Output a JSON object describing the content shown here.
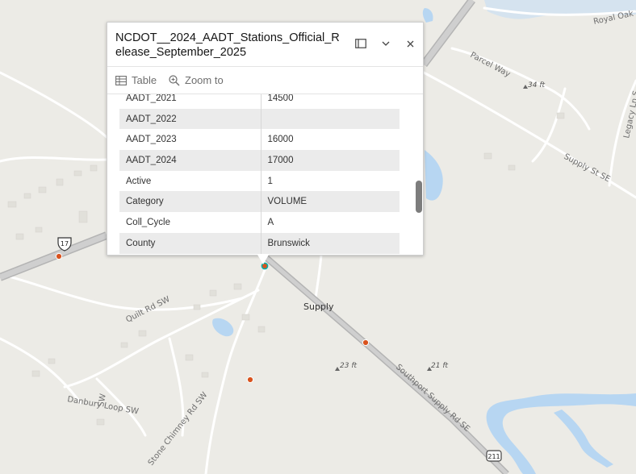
{
  "map": {
    "town_label": "Supply",
    "road_labels": {
      "southport_supply": "Southport Supply Rd SE",
      "quilt": "Quilt Rd SW",
      "danbury": "Danbury Loop SW",
      "stone_chimney": "Stone Chimney Rd SW",
      "parcel": "Parcel Way",
      "supply_st": "Supply St SE",
      "legacy": "Legacy Ln S",
      "royal_oak": "Royal Oak Swamp Rd"
    },
    "shields": {
      "us17": "17",
      "nc211": "211"
    },
    "elevations": [
      "34 ft",
      "23 ft",
      "21 ft"
    ]
  },
  "popup": {
    "title": "NCDOT__2024_AADT_Stations_Official_Release_September_2025",
    "dock_icon": "dock-icon",
    "collapse_icon": "chevron-down-icon",
    "close_icon": "close-icon",
    "actions": [
      {
        "label": "Table",
        "icon": "table-icon"
      },
      {
        "label": "Zoom to",
        "icon": "zoom-icon"
      }
    ],
    "rows": [
      {
        "field": "AADT_2021",
        "value": "14500"
      },
      {
        "field": "AADT_2022",
        "value": ""
      },
      {
        "field": "AADT_2023",
        "value": "16000"
      },
      {
        "field": "AADT_2024",
        "value": "17000"
      },
      {
        "field": "Active",
        "value": "1"
      },
      {
        "field": "Category",
        "value": "VOLUME"
      },
      {
        "field": "Coll_Cycle",
        "value": "A"
      },
      {
        "field": "County",
        "value": "Brunswick"
      }
    ]
  },
  "colors": {
    "land": "#ecebe6",
    "water": "#b7d6f2",
    "road_major": "#bdbdbd",
    "station_marker": "#d9531e"
  }
}
